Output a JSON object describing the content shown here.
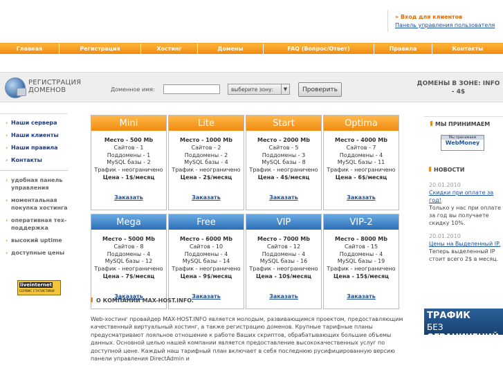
{
  "login": {
    "title": "Вход для клиентов",
    "link": "Панель управления пользователя"
  },
  "nav": [
    "Главная",
    "Регистрация",
    "Хостинг",
    "Домены",
    "FAQ (Вопрос/Ответ)",
    "Правила",
    "Контакты"
  ],
  "domain": {
    "title_1": "РЕГИСТРАЦИЯ",
    "title_2": "ДОМЕНОВ",
    "label": "Доменное имя:",
    "input_value": "",
    "zone_select": "выберите зону:",
    "zone_arrow": "▼",
    "button": "Проверить",
    "info": "ДОМЕНЫ В ЗОНЕ: INFO - 4$"
  },
  "left_menu": [
    "Наши сервера",
    "Наши клиенты",
    "Наши правила",
    "Контакты"
  ],
  "features": [
    "удобная панель управления",
    "моментальная покупка хостинга",
    "оперативная тех-поддержка",
    "высокий uptime",
    "доступные цены"
  ],
  "counter": {
    "line1": "liveinternet",
    "line2": "СЕРВИС СТАТИСТИКИ"
  },
  "plans": [
    {
      "name": "Mini",
      "color": "orange",
      "space": "Место - 500 Mb",
      "sites": "Сайтов - 1",
      "subdomains": "Поддомены - 1",
      "mysql": "MySQL базы - 2",
      "traffic": "Трафик - неограничено",
      "price": "Цена - 1$/месяц",
      "order": "Заказать"
    },
    {
      "name": "Lite",
      "color": "orange",
      "space": "Место - 1000 Mb",
      "sites": "Сайтов - 2",
      "subdomains": "Поддомены - 2",
      "mysql": "MySQL базы - 4",
      "traffic": "Трафик - неограничено",
      "price": "Цена - 2$/месяц",
      "order": "Заказать"
    },
    {
      "name": "Start",
      "color": "orange",
      "space": "Место - 2000 Mb",
      "sites": "Сайтов - 5",
      "subdomains": "Поддомены - 3",
      "mysql": "MySQL базы - 8",
      "traffic": "Трафик - неограничено",
      "price": "Цена - 4$/месяц",
      "order": "Заказать"
    },
    {
      "name": "Optima",
      "color": "orange",
      "space": "Место - 4000 Mb",
      "sites": "Сайтов - 7",
      "subdomains": "Поддомены - 4",
      "mysql": "MySQL базы - 11",
      "traffic": "Трафик - неограничено",
      "price": "Цена - 6$/месяц",
      "order": "Заказать"
    },
    {
      "name": "Mega",
      "color": "blue",
      "space": "Место - 5000 Mb",
      "sites": "Сайтов - 8",
      "subdomains": "Поддомены - 4",
      "mysql": "MySQL базы - 12",
      "traffic": "Трафик - неограничено",
      "price": "Цена - 7$/месяц",
      "order": "Заказать"
    },
    {
      "name": "Free",
      "color": "blue",
      "space": "Место - 6000 Mb",
      "sites": "Сайтов - 10",
      "subdomains": "Поддомены - 4",
      "mysql": "MySQL базы - 14",
      "traffic": "Трафик - неограничено",
      "price": "Цена - 9$/месяц",
      "order": "Заказать"
    },
    {
      "name": "VIP",
      "color": "blue",
      "space": "Место - 7000 Mb",
      "sites": "Сайтов - 12",
      "subdomains": "Поддомены - 4",
      "mysql": "MySQL базы - 16",
      "traffic": "Трафик - неограничено",
      "price": "Цена - 10$/месяц",
      "order": "Заказать"
    },
    {
      "name": "VIP-2",
      "color": "blue",
      "space": "Место - 8000 Mb",
      "sites": "Сайтов - 15",
      "subdomains": "Поддомены - 4",
      "mysql": "MySQL базы - 19",
      "traffic": "Трафик - неограничено",
      "price": "Цена - 15$/месяц",
      "order": "Заказать"
    }
  ],
  "about": {
    "heading": "О КОМПАНИИ MAX-HOST.INFO.",
    "text": "Web-хостинг провайдер MAX-HOST.INFO является молодым, развивающимся проектом, предоставляющим качественный виртуальный хостинг, а также регистрацию доменов. Крупные тарифные планы предусматривают лояльное отношение к работе Ваших скриптов, обрабатывающих большие объемы данных. Основной целью нашей компании является предоставление высококачественных услуг по доступной цене. Каждый наш тарифный план включает в себя последнюю русифицированную версию панели управления DirectAdmin и"
  },
  "accept": {
    "heading": "МЫ ПРИНИМАЕМ",
    "badge_top": "Мы принимаем",
    "badge_main": "WebMoney"
  },
  "news": {
    "heading": "НОВОСТИ",
    "items": [
      {
        "date": "20.01.2010",
        "title": "Скидки при оплате за год!",
        "text": "Только у нас при оплате за год вы получаете скидку 10%."
      },
      {
        "date": "20.01.2010",
        "title": "Цены на Выделенный IP.",
        "text": "Теперь выделенный IP стоит всего 2$ в месяц."
      }
    ]
  },
  "banner": {
    "line1": "ТРАФИК",
    "line2a": "БЕЗ",
    "line2b": "ОГРАНИЧЕНИЙ"
  },
  "colors": {
    "orange": "#f08a10",
    "blue": "#2b6fb8",
    "link": "#1a4e9c"
  }
}
